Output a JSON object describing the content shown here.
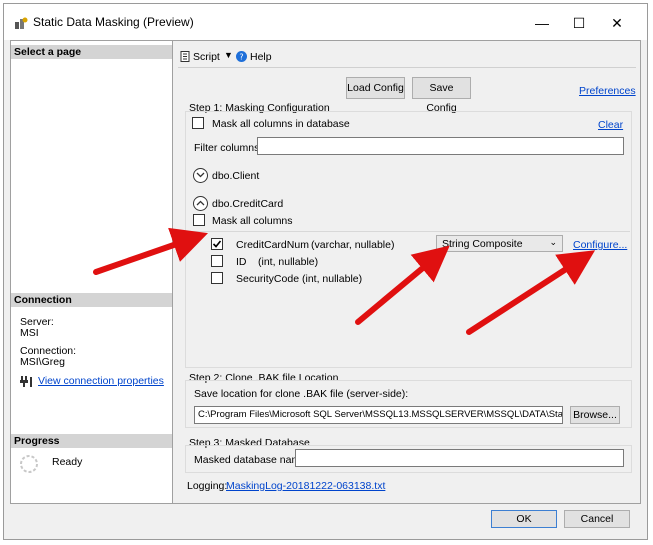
{
  "window": {
    "title": "Static Data Masking (Preview)",
    "minimize": "—",
    "maximize": "☐",
    "close": "✕"
  },
  "sidebar": {
    "select_page": "Select a page",
    "connection_header": "Connection",
    "server_label": "Server:",
    "server_value": "MSI",
    "connection_label": "Connection:",
    "connection_value": "MSI\\Greg",
    "view_properties": "View connection properties",
    "progress_header": "Progress",
    "progress_status": "Ready"
  },
  "toolbar": {
    "script": "Script",
    "help": "Help"
  },
  "config": {
    "load": "Load Config",
    "save": "Save Config",
    "preferences": "Preferences"
  },
  "step1": {
    "title": "Step 1: Masking Configuration",
    "mask_all_db": "Mask all columns in database",
    "clear": "Clear",
    "filter_label": "Filter columns:",
    "filter_value": "",
    "tables": [
      {
        "name": "dbo.Client",
        "expanded": false
      },
      {
        "name": "dbo.CreditCard",
        "expanded": true
      }
    ],
    "mask_all_columns": "Mask all columns",
    "columns": [
      {
        "name": "CreditCardNum",
        "type": "(varchar, nullable)",
        "checked": true,
        "function": "String Composite",
        "configure": "Configure..."
      },
      {
        "name": "ID",
        "type": "(int, nullable)",
        "checked": false
      },
      {
        "name": "SecurityCode",
        "type": "(int, nullable)",
        "checked": false
      }
    ]
  },
  "step2": {
    "title": "Step 2: Clone .BAK file Location",
    "save_label": "Save location for clone .BAK file (server-side):",
    "path": "C:\\Program Files\\Microsoft SQL Server\\MSSQL13.MSSQLSERVER\\MSSQL\\DATA\\StaticDa",
    "browse": "Browse..."
  },
  "step3": {
    "title": "Step 3: Masked Database",
    "name_label": "Masked database name:",
    "name_value": ""
  },
  "logging": {
    "label": "Logging:",
    "file": "MaskingLog-20181222-063138.txt"
  },
  "footer": {
    "ok": "OK",
    "cancel": "Cancel"
  },
  "colors": {
    "accent_link": "#0044cc",
    "arrow": "#e01010",
    "highlight_border": "#3c7fd2"
  }
}
